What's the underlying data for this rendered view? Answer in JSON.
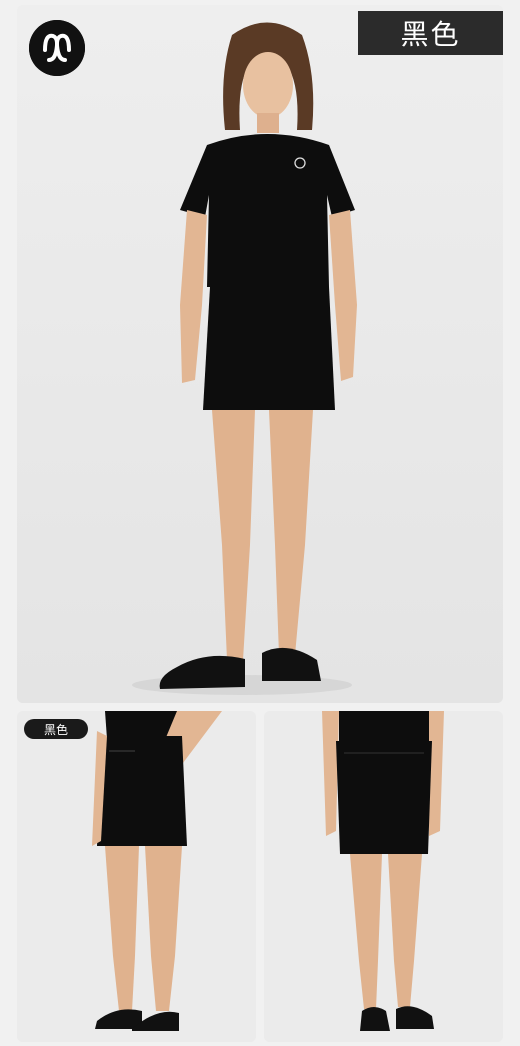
{
  "brand": {
    "logo_icon": "lululemon-logo-icon"
  },
  "main_image": {
    "color_label": "黑色",
    "subject": "model-wearing-black-tee-and-skirt"
  },
  "detail_images": [
    {
      "color_label": "黑色",
      "subject": "skirt-front-view"
    },
    {
      "subject": "skirt-back-view"
    }
  ],
  "colors": {
    "garment": "#0d0d0d",
    "background": "#e9e9e9",
    "tag_dark": "#2b2b2b"
  }
}
